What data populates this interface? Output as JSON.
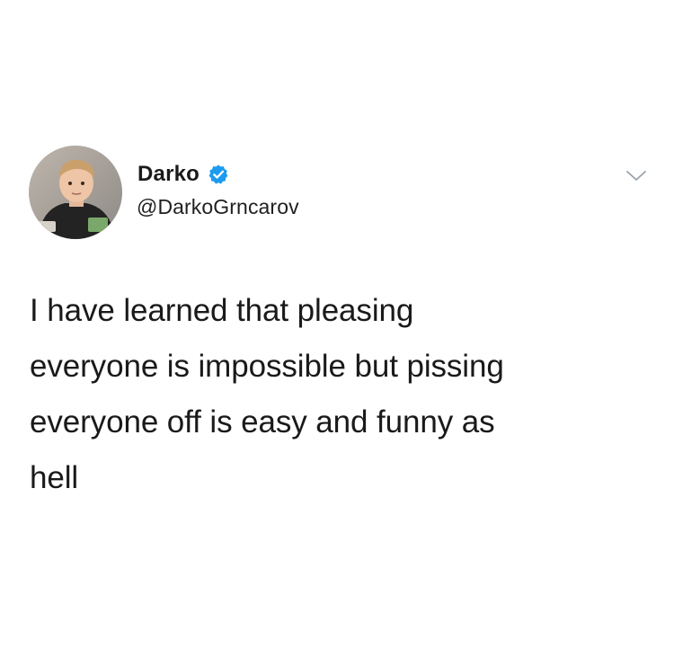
{
  "author": {
    "display_name": "Darko",
    "handle": "@DarkoGrncarov",
    "verified": true,
    "verified_color": "#1d9bf0"
  },
  "tweet": {
    "text": "I have learned that pleasing\neveryone is impossible but pissing\neveryone off is easy and funny as\nhell"
  },
  "icons": {
    "menu": "chevron-down-icon",
    "verified": "verified-badge-icon"
  }
}
